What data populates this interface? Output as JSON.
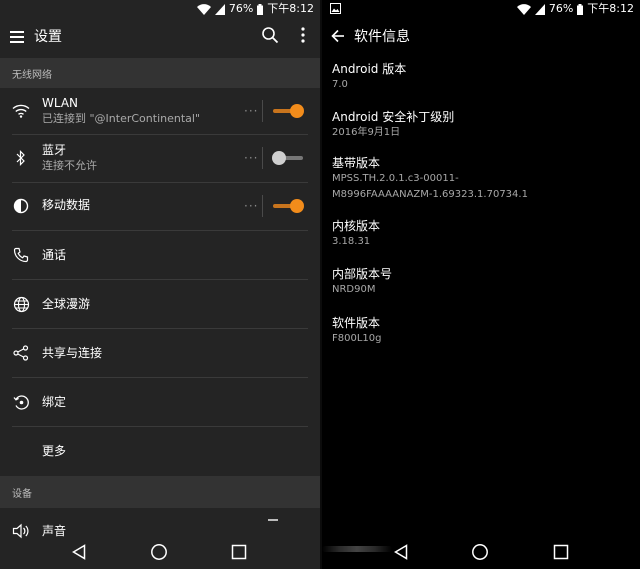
{
  "status_bar": {
    "battery": "76%",
    "time": "下午8:12"
  },
  "settings": {
    "title": "设置",
    "sections": {
      "wireless": "无线网络",
      "device": "设备"
    },
    "items": [
      {
        "label": "WLAN",
        "sub": "已连接到 \"@InterContinental\"",
        "toggle": "on",
        "icon": "wifi-icon"
      },
      {
        "label": "蓝牙",
        "sub": "连接不允许",
        "toggle": "off",
        "icon": "bluetooth-icon"
      },
      {
        "label": "移动数据",
        "sub": "",
        "toggle": "on",
        "icon": "data-usage-icon"
      },
      {
        "label": "通话",
        "sub": "",
        "icon": "phone-icon"
      },
      {
        "label": "全球漫游",
        "sub": "",
        "icon": "globe-icon"
      },
      {
        "label": "共享与连接",
        "sub": "",
        "icon": "share-icon"
      },
      {
        "label": "绑定",
        "sub": "",
        "icon": "tethering-icon"
      },
      {
        "label": "更多",
        "sub": ""
      },
      {
        "label": "声音",
        "sub": "",
        "icon": "sound-icon"
      }
    ]
  },
  "software_info": {
    "title": "软件信息",
    "entries": [
      {
        "key": "Android 版本",
        "value": "7.0"
      },
      {
        "key": "Android 安全补丁级别",
        "value": "2016年9月1日"
      },
      {
        "key": "基带版本",
        "value": "MPSS.TH.2.0.1.c3-00011-",
        "value2": "M8996FAAAANAZM-1.69323.1.70734.1"
      },
      {
        "key": "内核版本",
        "value": "3.18.31"
      },
      {
        "key": "内部版本号",
        "value": "NRD90M"
      },
      {
        "key": "软件版本",
        "value": "F800L10g"
      }
    ]
  },
  "colors": {
    "accent": "#f28c1b",
    "left_bg": "#242424",
    "section_bg": "#333333",
    "right_bg": "#000000"
  }
}
